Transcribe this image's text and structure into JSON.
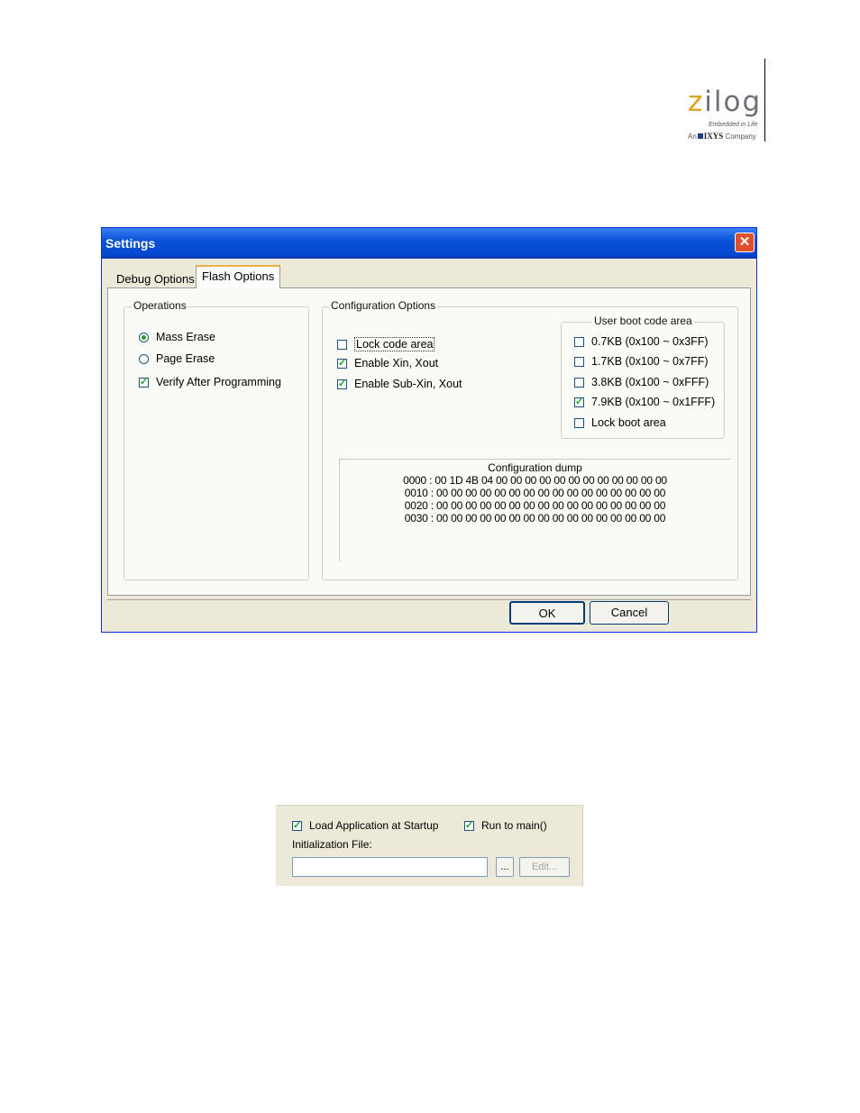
{
  "logo": {
    "word_first": "z",
    "word_rest": "ilog",
    "tagline": "Embedded in Life",
    "company_prefix": "An",
    "company_name": "IXYS",
    "company_suffix": "Company"
  },
  "dialog": {
    "title": "Settings",
    "close_symbol": "✕",
    "tabs": [
      "Debug Options",
      "Flash Options"
    ],
    "operations": {
      "legend": "Operations",
      "mass_erase": "Mass Erase",
      "page_erase": "Page Erase",
      "verify": "Verify After Programming"
    },
    "config": {
      "legend": "Configuration Options",
      "lock_code": "Lock code area",
      "enable_xin": "Enable Xin, Xout",
      "enable_subxin": "Enable Sub-Xin, Xout"
    },
    "boot": {
      "legend": "User boot code area",
      "items": [
        "0.7KB (0x100 ~ 0x3FF)",
        "1.7KB (0x100 ~ 0x7FF)",
        "3.8KB (0x100 ~ 0xFFF)",
        "7.9KB (0x100 ~ 0x1FFF)",
        "Lock boot area"
      ]
    },
    "dump": {
      "title": "Configuration dump",
      "lines": [
        "0000 : 00 1D 4B 04 00 00 00 00 00 00 00 00 00 00 00 00",
        "0010 : 00 00 00 00 00 00 00 00 00 00 00 00 00 00 00 00",
        "0020 : 00 00 00 00 00 00 00 00 00 00 00 00 00 00 00 00",
        "0030 : 00 00 00 00 00 00 00 00 00 00 00 00 00 00 00 00"
      ]
    },
    "ok": "OK",
    "cancel": "Cancel"
  },
  "snippet": {
    "load_app": "Load Application at Startup",
    "run_main": "Run to main()",
    "init_label": "Initialization File:",
    "browse": "...",
    "edit": "Edit..."
  }
}
